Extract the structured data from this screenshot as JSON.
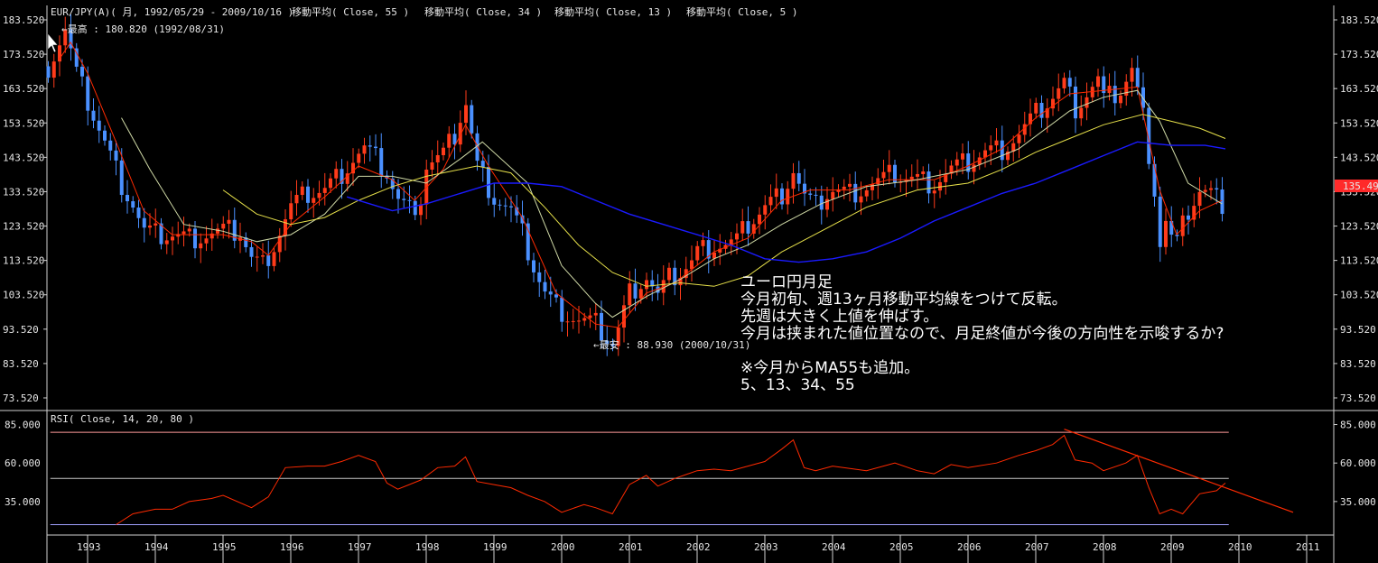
{
  "header": {
    "symbol_line": "EUR/JPY(A)( 月, 1992/05/29 - 2009/10/16 )",
    "ma_labels": [
      "移動平均( Close, 55 )",
      "移動平均( Close, 34 )",
      "移動平均( Close, 13 )",
      "移動平均( Close, 5 )"
    ]
  },
  "annotations": {
    "high": "←最高 : 180.820 (1992/08/31)",
    "low": "←最安 : 88.930 (2000/10/31)",
    "price_tag": "135.490"
  },
  "notes": [
    "ユーロ円月足",
    "今月初旬、週13ヶ月移動平均線をつけて反転。",
    "先週は大きく上値を伸ばす。",
    "今月は挟まれた値位置なので、月足終値が今後の方向性を示唆するか?",
    "",
    "※今月からMA55も追加。",
    "5、13、34、55"
  ],
  "rsi": {
    "label": "RSI( Close, 14, 20, 80 )",
    "tick_labels": [
      "85.000",
      "60.000",
      "35.000"
    ]
  },
  "colors": {
    "background": "#000000",
    "up_candle": "#ff3b1a",
    "down_candle": "#4a90ff",
    "ma5": "#ff2a00",
    "ma13": "#cfd9a6",
    "ma34": "#e6e04a",
    "ma55": "#1a1aff",
    "rsi_line": "#ff2a00",
    "rsi_trend": "#ff2a00",
    "rsi_band_upper": "#ff9a9a",
    "rsi_band_mid": "#c8c8c8",
    "rsi_band_lower": "#a0a0ff"
  },
  "chart_data": {
    "type": "candlestick",
    "title": "EUR/JPY(A)( 月, 1992/05/29 - 2009/10/16 )",
    "price_axis": {
      "range": [
        73.52,
        183.52
      ],
      "ticks": [
        "183.520",
        "173.520",
        "163.520",
        "153.520",
        "143.520",
        "133.520",
        "123.520",
        "113.520",
        "103.520",
        "93.520",
        "83.520",
        "73.520"
      ]
    },
    "x_axis": {
      "range": [
        1992.4,
        2011.4
      ],
      "years": [
        "1993",
        "1994",
        "1995",
        "1996",
        "1997",
        "1998",
        "1999",
        "2000",
        "2001",
        "2002",
        "2003",
        "2004",
        "2005",
        "2006",
        "2007",
        "2008",
        "2009",
        "2010",
        "2011"
      ]
    },
    "close_path": [
      [
        1992.42,
        170
      ],
      [
        1992.67,
        180.8
      ],
      [
        1992.83,
        168
      ],
      [
        1993.0,
        160
      ],
      [
        1993.25,
        148
      ],
      [
        1993.5,
        136
      ],
      [
        1993.67,
        130
      ],
      [
        1993.83,
        122
      ],
      [
        1994.0,
        121
      ],
      [
        1994.25,
        121
      ],
      [
        1994.5,
        120
      ],
      [
        1994.75,
        121
      ],
      [
        1995.0,
        122
      ],
      [
        1995.25,
        122
      ],
      [
        1995.42,
        114
      ],
      [
        1995.58,
        112
      ],
      [
        1995.75,
        118
      ],
      [
        1996.0,
        129
      ],
      [
        1996.25,
        133
      ],
      [
        1996.5,
        134
      ],
      [
        1996.75,
        139
      ],
      [
        1996.92,
        143
      ],
      [
        1997.08,
        146
      ],
      [
        1997.25,
        143
      ],
      [
        1997.42,
        139
      ],
      [
        1997.58,
        131
      ],
      [
        1997.75,
        128
      ],
      [
        1997.92,
        132
      ],
      [
        1998.0,
        141
      ],
      [
        1998.25,
        144
      ],
      [
        1998.42,
        150
      ],
      [
        1998.58,
        160
      ],
      [
        1998.75,
        141
      ],
      [
        1998.92,
        135
      ],
      [
        1999.0,
        132
      ],
      [
        1999.25,
        128
      ],
      [
        1999.42,
        121
      ],
      [
        1999.58,
        112
      ],
      [
        1999.75,
        104
      ],
      [
        1999.92,
        100
      ],
      [
        2000.0,
        99
      ],
      [
        2000.25,
        96
      ],
      [
        2000.5,
        95
      ],
      [
        2000.75,
        89
      ],
      [
        2000.83,
        93
      ],
      [
        2001.0,
        104
      ],
      [
        2001.25,
        109
      ],
      [
        2001.42,
        103
      ],
      [
        2001.58,
        108
      ],
      [
        2001.75,
        110
      ],
      [
        2001.92,
        113
      ],
      [
        2002.0,
        116
      ],
      [
        2002.25,
        118
      ],
      [
        2002.42,
        118
      ],
      [
        2002.58,
        119
      ],
      [
        2002.75,
        124
      ],
      [
        2003.0,
        129
      ],
      [
        2003.25,
        133
      ],
      [
        2003.42,
        140
      ],
      [
        2003.58,
        132
      ],
      [
        2003.75,
        129
      ],
      [
        2003.92,
        133
      ],
      [
        2004.0,
        134
      ],
      [
        2004.25,
        133
      ],
      [
        2004.5,
        135
      ],
      [
        2004.75,
        137
      ],
      [
        2004.92,
        139
      ],
      [
        2005.0,
        138
      ],
      [
        2005.25,
        137
      ],
      [
        2005.5,
        136
      ],
      [
        2005.75,
        140
      ],
      [
        2006.0,
        142
      ],
      [
        2006.25,
        145
      ],
      [
        2006.5,
        146
      ],
      [
        2006.75,
        150
      ],
      [
        2007.0,
        156
      ],
      [
        2007.25,
        161
      ],
      [
        2007.42,
        165
      ],
      [
        2007.58,
        158
      ],
      [
        2007.75,
        162
      ],
      [
        2007.92,
        166
      ],
      [
        2008.0,
        160
      ],
      [
        2008.25,
        163
      ],
      [
        2008.42,
        169
      ],
      [
        2008.58,
        156
      ],
      [
        2008.75,
        135
      ],
      [
        2008.83,
        118
      ],
      [
        2008.92,
        125
      ],
      [
        2009.0,
        120
      ],
      [
        2009.08,
        118
      ],
      [
        2009.25,
        128
      ],
      [
        2009.42,
        134
      ],
      [
        2009.58,
        133
      ],
      [
        2009.75,
        130
      ],
      [
        2009.8,
        135.49
      ]
    ],
    "moving_averages": [
      {
        "name": "移動平均( Close, 5 )",
        "period": 5,
        "points": [
          [
            1992.58,
            172
          ],
          [
            1992.75,
            177
          ],
          [
            1993.0,
            168
          ],
          [
            1993.42,
            148
          ],
          [
            1993.83,
            128
          ],
          [
            1994.25,
            121
          ],
          [
            1995.0,
            121
          ],
          [
            1995.42,
            119
          ],
          [
            1995.67,
            115
          ],
          [
            1996.0,
            124
          ],
          [
            1996.5,
            132
          ],
          [
            1997.0,
            141
          ],
          [
            1997.5,
            137
          ],
          [
            1997.83,
            131
          ],
          [
            1998.25,
            140
          ],
          [
            1998.58,
            153
          ],
          [
            1998.92,
            141
          ],
          [
            1999.42,
            126
          ],
          [
            1999.92,
            104
          ],
          [
            2000.5,
            95
          ],
          [
            2000.83,
            94
          ],
          [
            2001.25,
            104
          ],
          [
            2001.67,
            107
          ],
          [
            2002.25,
            116
          ],
          [
            2002.75,
            120
          ],
          [
            2003.25,
            131
          ],
          [
            2003.67,
            134
          ],
          [
            2004.25,
            134
          ],
          [
            2004.83,
            137
          ],
          [
            2005.5,
            137
          ],
          [
            2006.0,
            141
          ],
          [
            2006.5,
            146
          ],
          [
            2007.0,
            155
          ],
          [
            2007.5,
            162
          ],
          [
            2008.0,
            163
          ],
          [
            2008.5,
            164
          ],
          [
            2008.83,
            134
          ],
          [
            2009.08,
            121
          ],
          [
            2009.42,
            128
          ],
          [
            2009.75,
            131
          ]
        ]
      },
      {
        "name": "移動平均( Close, 13 )",
        "period": 13,
        "points": [
          [
            1993.5,
            155
          ],
          [
            1993.92,
            140
          ],
          [
            1994.42,
            124
          ],
          [
            1995.0,
            122
          ],
          [
            1995.5,
            119
          ],
          [
            1996.0,
            121
          ],
          [
            1996.5,
            127
          ],
          [
            1997.0,
            138
          ],
          [
            1997.5,
            138
          ],
          [
            1998.0,
            136
          ],
          [
            1998.5,
            143
          ],
          [
            1998.83,
            148
          ],
          [
            1999.5,
            136
          ],
          [
            2000.0,
            112
          ],
          [
            2000.5,
            101
          ],
          [
            2000.75,
            97
          ],
          [
            2001.25,
            103
          ],
          [
            2001.75,
            108
          ],
          [
            2002.25,
            114
          ],
          [
            2002.75,
            118
          ],
          [
            2003.25,
            124
          ],
          [
            2003.83,
            130
          ],
          [
            2004.5,
            135
          ],
          [
            2005.25,
            137
          ],
          [
            2006.0,
            140
          ],
          [
            2006.75,
            146
          ],
          [
            2007.5,
            157
          ],
          [
            2008.0,
            161
          ],
          [
            2008.5,
            163
          ],
          [
            2008.83,
            154
          ],
          [
            2009.25,
            136
          ],
          [
            2009.75,
            130
          ]
        ]
      },
      {
        "name": "移動平均( Close, 34 )",
        "period": 34,
        "points": [
          [
            1995.0,
            134
          ],
          [
            1995.5,
            127
          ],
          [
            1996.0,
            124
          ],
          [
            1996.5,
            126
          ],
          [
            1997.0,
            131
          ],
          [
            1997.5,
            135
          ],
          [
            1998.0,
            138
          ],
          [
            1998.75,
            141
          ],
          [
            1999.25,
            139
          ],
          [
            1999.75,
            129
          ],
          [
            2000.25,
            118
          ],
          [
            2000.75,
            110
          ],
          [
            2001.25,
            106
          ],
          [
            2001.75,
            107
          ],
          [
            2002.25,
            106
          ],
          [
            2002.75,
            109
          ],
          [
            2003.25,
            116
          ],
          [
            2003.83,
            122
          ],
          [
            2004.5,
            129
          ],
          [
            2005.25,
            134
          ],
          [
            2006.0,
            136
          ],
          [
            2006.5,
            140
          ],
          [
            2007.0,
            145
          ],
          [
            2007.5,
            149
          ],
          [
            2008.0,
            153
          ],
          [
            2008.58,
            156
          ],
          [
            2009.0,
            154
          ],
          [
            2009.42,
            152
          ],
          [
            2009.8,
            149
          ]
        ]
      },
      {
        "name": "移動平均( Close, 55 )",
        "period": 55,
        "points": [
          [
            1996.83,
            132
          ],
          [
            1997.5,
            128
          ],
          [
            1998.0,
            130
          ],
          [
            1998.5,
            133
          ],
          [
            1999.0,
            136
          ],
          [
            1999.5,
            136
          ],
          [
            2000.0,
            135
          ],
          [
            2000.5,
            131
          ],
          [
            2001.0,
            127
          ],
          [
            2001.5,
            124
          ],
          [
            2002.0,
            121
          ],
          [
            2002.5,
            118
          ],
          [
            2003.0,
            114
          ],
          [
            2003.5,
            113
          ],
          [
            2004.0,
            114
          ],
          [
            2004.5,
            116
          ],
          [
            2005.0,
            120
          ],
          [
            2005.5,
            125
          ],
          [
            2006.0,
            129
          ],
          [
            2006.5,
            133
          ],
          [
            2007.0,
            136
          ],
          [
            2007.5,
            140
          ],
          [
            2008.0,
            144
          ],
          [
            2008.5,
            148
          ],
          [
            2009.0,
            147
          ],
          [
            2009.5,
            147
          ],
          [
            2009.8,
            146
          ]
        ]
      }
    ],
    "rsi": {
      "series_name": "RSI( Close, 14, 20, 80 )",
      "range": [
        15,
        90
      ],
      "bands": [
        80,
        50,
        20
      ],
      "points": [
        [
          1993.42,
          20
        ],
        [
          1993.67,
          27
        ],
        [
          1994.0,
          30
        ],
        [
          1994.25,
          30
        ],
        [
          1994.5,
          35
        ],
        [
          1994.83,
          37
        ],
        [
          1995.0,
          39
        ],
        [
          1995.42,
          31
        ],
        [
          1995.67,
          38
        ],
        [
          1995.92,
          57
        ],
        [
          1996.25,
          58
        ],
        [
          1996.5,
          58
        ],
        [
          1996.75,
          61
        ],
        [
          1997.0,
          65
        ],
        [
          1997.25,
          61
        ],
        [
          1997.42,
          47
        ],
        [
          1997.58,
          43
        ],
        [
          1997.92,
          49
        ],
        [
          1998.17,
          57
        ],
        [
          1998.42,
          58
        ],
        [
          1998.58,
          64
        ],
        [
          1998.75,
          48
        ],
        [
          1999.0,
          46
        ],
        [
          1999.25,
          44
        ],
        [
          1999.5,
          39
        ],
        [
          1999.75,
          35
        ],
        [
          2000.0,
          28
        ],
        [
          2000.33,
          33
        ],
        [
          2000.5,
          31
        ],
        [
          2000.75,
          27
        ],
        [
          2001.0,
          46
        ],
        [
          2001.25,
          52
        ],
        [
          2001.42,
          45
        ],
        [
          2001.67,
          50
        ],
        [
          2002.0,
          55
        ],
        [
          2002.25,
          56
        ],
        [
          2002.5,
          55
        ],
        [
          2002.75,
          58
        ],
        [
          2003.0,
          61
        ],
        [
          2003.25,
          69
        ],
        [
          2003.42,
          75
        ],
        [
          2003.58,
          57
        ],
        [
          2003.75,
          55
        ],
        [
          2004.0,
          58
        ],
        [
          2004.5,
          55
        ],
        [
          2004.92,
          60
        ],
        [
          2005.25,
          55
        ],
        [
          2005.5,
          53
        ],
        [
          2005.75,
          59
        ],
        [
          2006.0,
          57
        ],
        [
          2006.42,
          60
        ],
        [
          2006.75,
          65
        ],
        [
          2007.0,
          68
        ],
        [
          2007.25,
          72
        ],
        [
          2007.42,
          78
        ],
        [
          2007.58,
          62
        ],
        [
          2007.83,
          60
        ],
        [
          2008.0,
          55
        ],
        [
          2008.33,
          60
        ],
        [
          2008.5,
          65
        ],
        [
          2008.67,
          44
        ],
        [
          2008.83,
          27
        ],
        [
          2009.0,
          30
        ],
        [
          2009.17,
          27
        ],
        [
          2009.42,
          40
        ],
        [
          2009.67,
          42
        ],
        [
          2009.8,
          47
        ]
      ],
      "trendline": [
        [
          2007.42,
          82
        ],
        [
          2010.8,
          28
        ]
      ]
    }
  }
}
